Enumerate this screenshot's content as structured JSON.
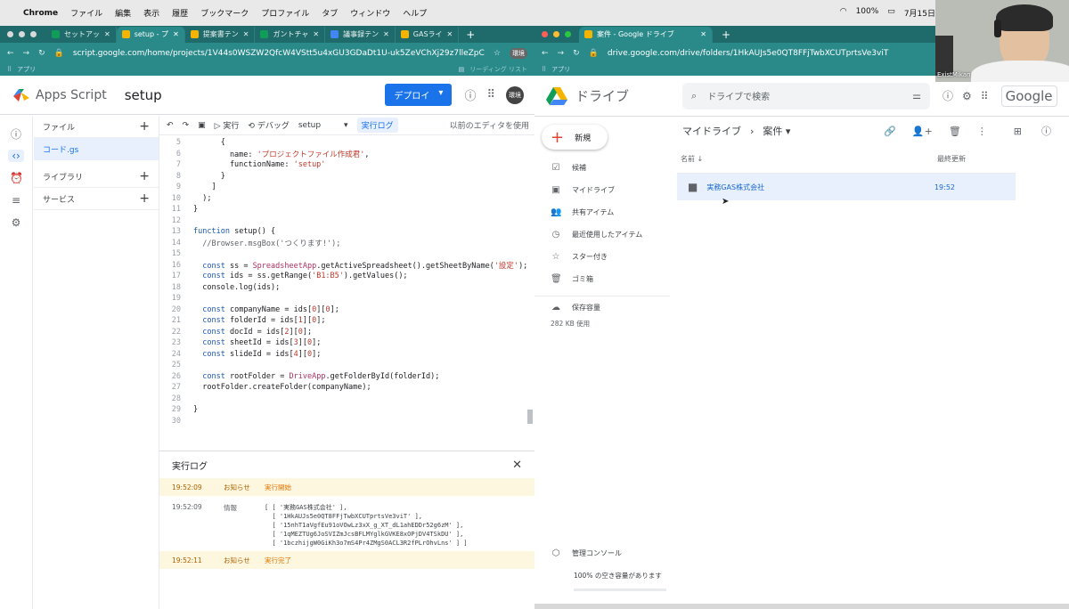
{
  "menubar": {
    "apple": "",
    "app": "Chrome",
    "items": [
      "ファイル",
      "編集",
      "表示",
      "履歴",
      "ブックマーク",
      "プロファイル",
      "タブ",
      "ウィンドウ",
      "ヘルプ"
    ],
    "status": {
      "battery": "100%",
      "date": "7月15日"
    }
  },
  "left_window": {
    "tabs": [
      {
        "label": "セットアッ",
        "color": "#0f9d58"
      },
      {
        "label": "setup - プ",
        "color": "#f4b400",
        "active": true
      },
      {
        "label": "提案書テン",
        "color": "#f4b400"
      },
      {
        "label": "ガントチャ",
        "color": "#0f9d58"
      },
      {
        "label": "議事録テン",
        "color": "#4285f4"
      },
      {
        "label": "GASライ",
        "color": "#f4b400"
      }
    ],
    "url": "script.google.com/home/projects/1V44s0WSZW2QfcW4VStt5u4xGU3GDaDt1U-uk5ZeVChXj29z7lleZpC...",
    "bookmark": "アプリ",
    "bookmark_right": "リーディング リスト",
    "avatar": "環境"
  },
  "apps_script": {
    "brand": "Apps Script",
    "project": "setup",
    "deploy": "デプロイ",
    "avatar": "環境",
    "files_header": "ファイル",
    "file": "コード.gs",
    "libraries": "ライブラリ",
    "services": "サービス",
    "toolbar": {
      "run": "実行",
      "debug": "デバッグ",
      "function": "setup",
      "log": "実行ログ",
      "legacy": "以前のエディタを使用"
    },
    "code_lines": [
      {
        "n": "5",
        "html": "      {"
      },
      {
        "n": "6",
        "html": "        name: <span class='str'>'プロジェクトファイル作成君'</span>,"
      },
      {
        "n": "7",
        "html": "        functionName: <span class='str'>'setup'</span>"
      },
      {
        "n": "8",
        "html": "      }"
      },
      {
        "n": "9",
        "html": "    ]"
      },
      {
        "n": "10",
        "html": "  );"
      },
      {
        "n": "11",
        "html": "}"
      },
      {
        "n": "12",
        "html": ""
      },
      {
        "n": "13",
        "html": "<span class='kw'>function</span> setup() {"
      },
      {
        "n": "14",
        "html": "  <span class='cm'>//Browser.msgBox('つくります!');</span>"
      },
      {
        "n": "15",
        "html": ""
      },
      {
        "n": "16",
        "html": "  <span class='kw'>const</span> ss = <span class='cls'>SpreadsheetApp</span>.getActiveSpreadsheet().getSheetByName(<span class='str'>'設定'</span>);"
      },
      {
        "n": "17",
        "html": "  <span class='kw'>const</span> ids = ss.getRange(<span class='str'>'B1:B5'</span>).getValues();"
      },
      {
        "n": "18",
        "html": "  console.log(ids);"
      },
      {
        "n": "19",
        "html": ""
      },
      {
        "n": "20",
        "html": "  <span class='kw'>const</span> companyName = ids[<span class='str'>0</span>][<span class='str'>0</span>];"
      },
      {
        "n": "21",
        "html": "  <span class='kw'>const</span> folderId = ids[<span class='str'>1</span>][<span class='str'>0</span>];"
      },
      {
        "n": "22",
        "html": "  <span class='kw'>const</span> docId = ids[<span class='str'>2</span>][<span class='str'>0</span>];"
      },
      {
        "n": "23",
        "html": "  <span class='kw'>const</span> sheetId = ids[<span class='str'>3</span>][<span class='str'>0</span>];"
      },
      {
        "n": "24",
        "html": "  <span class='kw'>const</span> slideId = ids[<span class='str'>4</span>][<span class='str'>0</span>];"
      },
      {
        "n": "25",
        "html": ""
      },
      {
        "n": "26",
        "html": "  <span class='kw'>const</span> rootFolder = <span class='cls'>DriveApp</span>.getFolderById(folderId);"
      },
      {
        "n": "27",
        "html": "  rootFolder.createFolder(companyName);"
      },
      {
        "n": "28",
        "html": ""
      },
      {
        "n": "29",
        "html": "}"
      },
      {
        "n": "30",
        "html": ""
      }
    ],
    "log": {
      "title": "実行ログ",
      "rows": [
        {
          "time": "19:52:09",
          "level": "お知らせ",
          "msg": "実行開始",
          "notice": true
        },
        {
          "time": "19:52:09",
          "level": "情報",
          "msg": "[ [ '実務GAS株式会社' ],\n  [ '1HkAUJs5e0QT8FFjTwbXCUTprtsVe3viT' ],\n  [ '15nhT1aVgfEu91oVOwLz3xX_g_XT_dL1ahEDDr52g6zM' ],\n  [ '1qMEZTUg6JoSVIZmJcsBFLMYglkGVKE8xOPjDV4TSkDU' ],\n  [ '1bczhijgW0GiKh3o7mS4Pr4ZMgS0ACL3R2fPLrOhvLns' ] ]",
          "notice": false
        },
        {
          "time": "19:52:11",
          "level": "お知らせ",
          "msg": "実行完了",
          "notice": true
        }
      ]
    }
  },
  "right_window": {
    "tab": "案件 - Google ドライブ",
    "url": "drive.google.com/drive/folders/1HkAUJs5e0QT8FFjTwbXCUTprtsVe3viT",
    "bookmark": "アプリ"
  },
  "drive": {
    "brand": "ドライブ",
    "search_placeholder": "ドライブで検索",
    "google": "Google",
    "new": "新規",
    "nav": [
      {
        "label": "候補",
        "icon": "✓"
      },
      {
        "label": "マイドライブ",
        "icon": "▣"
      },
      {
        "label": "共有アイテム",
        "icon": "👥"
      },
      {
        "label": "最近使用したアイテム",
        "icon": "◷"
      },
      {
        "label": "スター付き",
        "icon": "☆"
      },
      {
        "label": "ゴミ箱",
        "icon": "🗑"
      }
    ],
    "storage": "保存容量",
    "storage_used": "282 KB 使用",
    "admin": "管理コンソール",
    "free": "100% の空き容量があります",
    "breadcrumb_root": "マイドライブ",
    "breadcrumb_current": "案件",
    "col_name": "名前",
    "col_modified": "最終更新",
    "folder": {
      "name": "実務GAS株式会社",
      "modified": "19:52"
    }
  },
  "webcam": {
    "label": "ExistMikan"
  }
}
